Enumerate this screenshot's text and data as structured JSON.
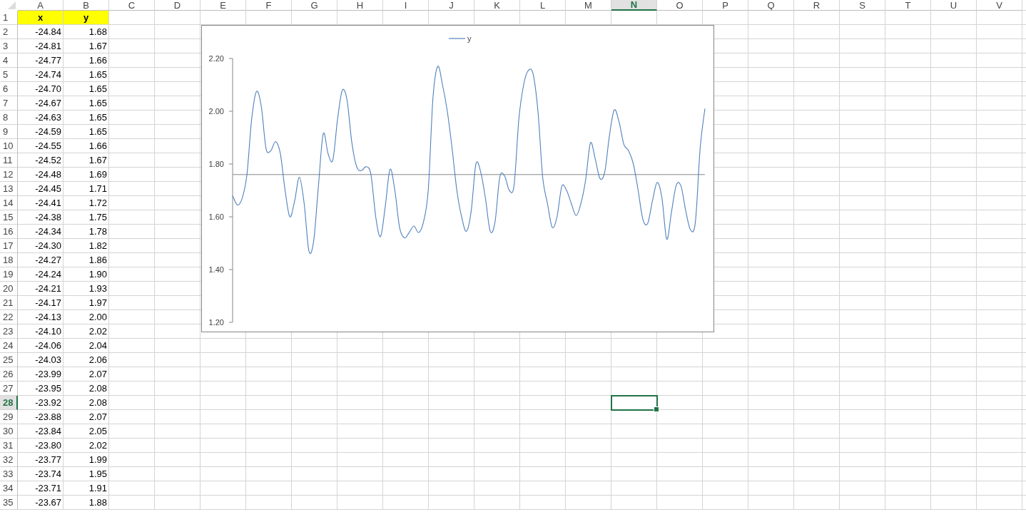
{
  "sheet": {
    "columns": [
      {
        "label": "A",
        "selected": false
      },
      {
        "label": "B",
        "selected": false
      },
      {
        "label": "C",
        "selected": false
      },
      {
        "label": "D",
        "selected": false
      },
      {
        "label": "E",
        "selected": false
      },
      {
        "label": "F",
        "selected": false
      },
      {
        "label": "G",
        "selected": false
      },
      {
        "label": "H",
        "selected": false
      },
      {
        "label": "I",
        "selected": false
      },
      {
        "label": "J",
        "selected": false
      },
      {
        "label": "K",
        "selected": false
      },
      {
        "label": "L",
        "selected": false
      },
      {
        "label": "M",
        "selected": false
      },
      {
        "label": "N",
        "selected": true
      },
      {
        "label": "O",
        "selected": false
      },
      {
        "label": "P",
        "selected": false
      },
      {
        "label": "Q",
        "selected": false
      },
      {
        "label": "R",
        "selected": false
      },
      {
        "label": "S",
        "selected": false
      },
      {
        "label": "T",
        "selected": false
      },
      {
        "label": "U",
        "selected": false
      },
      {
        "label": "V",
        "selected": false
      }
    ],
    "rows": [
      {
        "number": "1",
        "selected": false,
        "cells": [
          {
            "text": "x",
            "kind": "header"
          },
          {
            "text": "y",
            "kind": "header"
          }
        ]
      },
      {
        "number": "2",
        "selected": false,
        "cells": [
          {
            "text": "-24.84",
            "kind": "number"
          },
          {
            "text": "1.68",
            "kind": "number"
          }
        ]
      },
      {
        "number": "3",
        "selected": false,
        "cells": [
          {
            "text": "-24.81",
            "kind": "number"
          },
          {
            "text": "1.67",
            "kind": "number"
          }
        ]
      },
      {
        "number": "4",
        "selected": false,
        "cells": [
          {
            "text": "-24.77",
            "kind": "number"
          },
          {
            "text": "1.66",
            "kind": "number"
          }
        ]
      },
      {
        "number": "5",
        "selected": false,
        "cells": [
          {
            "text": "-24.74",
            "kind": "number"
          },
          {
            "text": "1.65",
            "kind": "number"
          }
        ]
      },
      {
        "number": "6",
        "selected": false,
        "cells": [
          {
            "text": "-24.70",
            "kind": "number"
          },
          {
            "text": "1.65",
            "kind": "number"
          }
        ]
      },
      {
        "number": "7",
        "selected": false,
        "cells": [
          {
            "text": "-24.67",
            "kind": "number"
          },
          {
            "text": "1.65",
            "kind": "number"
          }
        ]
      },
      {
        "number": "8",
        "selected": false,
        "cells": [
          {
            "text": "-24.63",
            "kind": "number"
          },
          {
            "text": "1.65",
            "kind": "number"
          }
        ]
      },
      {
        "number": "9",
        "selected": false,
        "cells": [
          {
            "text": "-24.59",
            "kind": "number"
          },
          {
            "text": "1.65",
            "kind": "number"
          }
        ]
      },
      {
        "number": "10",
        "selected": false,
        "cells": [
          {
            "text": "-24.55",
            "kind": "number"
          },
          {
            "text": "1.66",
            "kind": "number"
          }
        ]
      },
      {
        "number": "11",
        "selected": false,
        "cells": [
          {
            "text": "-24.52",
            "kind": "number"
          },
          {
            "text": "1.67",
            "kind": "number"
          }
        ]
      },
      {
        "number": "12",
        "selected": false,
        "cells": [
          {
            "text": "-24.48",
            "kind": "number"
          },
          {
            "text": "1.69",
            "kind": "number"
          }
        ]
      },
      {
        "number": "13",
        "selected": false,
        "cells": [
          {
            "text": "-24.45",
            "kind": "number"
          },
          {
            "text": "1.71",
            "kind": "number"
          }
        ]
      },
      {
        "number": "14",
        "selected": false,
        "cells": [
          {
            "text": "-24.41",
            "kind": "number"
          },
          {
            "text": "1.72",
            "kind": "number"
          }
        ]
      },
      {
        "number": "15",
        "selected": false,
        "cells": [
          {
            "text": "-24.38",
            "kind": "number"
          },
          {
            "text": "1.75",
            "kind": "number"
          }
        ]
      },
      {
        "number": "16",
        "selected": false,
        "cells": [
          {
            "text": "-24.34",
            "kind": "number"
          },
          {
            "text": "1.78",
            "kind": "number"
          }
        ]
      },
      {
        "number": "17",
        "selected": false,
        "cells": [
          {
            "text": "-24.30",
            "kind": "number"
          },
          {
            "text": "1.82",
            "kind": "number"
          }
        ]
      },
      {
        "number": "18",
        "selected": false,
        "cells": [
          {
            "text": "-24.27",
            "kind": "number"
          },
          {
            "text": "1.86",
            "kind": "number"
          }
        ]
      },
      {
        "number": "19",
        "selected": false,
        "cells": [
          {
            "text": "-24.24",
            "kind": "number"
          },
          {
            "text": "1.90",
            "kind": "number"
          }
        ]
      },
      {
        "number": "20",
        "selected": false,
        "cells": [
          {
            "text": "-24.21",
            "kind": "number"
          },
          {
            "text": "1.93",
            "kind": "number"
          }
        ]
      },
      {
        "number": "21",
        "selected": false,
        "cells": [
          {
            "text": "-24.17",
            "kind": "number"
          },
          {
            "text": "1.97",
            "kind": "number"
          }
        ]
      },
      {
        "number": "22",
        "selected": false,
        "cells": [
          {
            "text": "-24.13",
            "kind": "number"
          },
          {
            "text": "2.00",
            "kind": "number"
          }
        ]
      },
      {
        "number": "23",
        "selected": false,
        "cells": [
          {
            "text": "-24.10",
            "kind": "number"
          },
          {
            "text": "2.02",
            "kind": "number"
          }
        ]
      },
      {
        "number": "24",
        "selected": false,
        "cells": [
          {
            "text": "-24.06",
            "kind": "number"
          },
          {
            "text": "2.04",
            "kind": "number"
          }
        ]
      },
      {
        "number": "25",
        "selected": false,
        "cells": [
          {
            "text": "-24.03",
            "kind": "number"
          },
          {
            "text": "2.06",
            "kind": "number"
          }
        ]
      },
      {
        "number": "26",
        "selected": false,
        "cells": [
          {
            "text": "-23.99",
            "kind": "number"
          },
          {
            "text": "2.07",
            "kind": "number"
          }
        ]
      },
      {
        "number": "27",
        "selected": false,
        "cells": [
          {
            "text": "-23.95",
            "kind": "number"
          },
          {
            "text": "2.08",
            "kind": "number"
          }
        ]
      },
      {
        "number": "28",
        "selected": true,
        "cells": [
          {
            "text": "-23.92",
            "kind": "number"
          },
          {
            "text": "2.08",
            "kind": "number"
          }
        ]
      },
      {
        "number": "29",
        "selected": false,
        "cells": [
          {
            "text": "-23.88",
            "kind": "number"
          },
          {
            "text": "2.07",
            "kind": "number"
          }
        ]
      },
      {
        "number": "30",
        "selected": false,
        "cells": [
          {
            "text": "-23.84",
            "kind": "number"
          },
          {
            "text": "2.05",
            "kind": "number"
          }
        ]
      },
      {
        "number": "31",
        "selected": false,
        "cells": [
          {
            "text": "-23.80",
            "kind": "number"
          },
          {
            "text": "2.02",
            "kind": "number"
          }
        ]
      },
      {
        "number": "32",
        "selected": false,
        "cells": [
          {
            "text": "-23.77",
            "kind": "number"
          },
          {
            "text": "1.99",
            "kind": "number"
          }
        ]
      },
      {
        "number": "33",
        "selected": false,
        "cells": [
          {
            "text": "-23.74",
            "kind": "number"
          },
          {
            "text": "1.95",
            "kind": "number"
          }
        ]
      },
      {
        "number": "34",
        "selected": false,
        "cells": [
          {
            "text": "-23.71",
            "kind": "number"
          },
          {
            "text": "1.91",
            "kind": "number"
          }
        ]
      },
      {
        "number": "35",
        "selected": false,
        "cells": [
          {
            "text": "-23.67",
            "kind": "number"
          },
          {
            "text": "1.88",
            "kind": "number"
          }
        ]
      }
    ],
    "chart": {
      "chart_data": {
        "type": "line",
        "ylim": [
          1.2,
          2.2
        ],
        "yticks": [
          {
            "value": 1.2,
            "label": "1.20"
          },
          {
            "value": 1.4,
            "label": "1.40"
          },
          {
            "value": 1.6,
            "label": "1.60"
          },
          {
            "value": 1.8,
            "label": "1.80"
          },
          {
            "value": 2.0,
            "label": "2.00"
          },
          {
            "value": 2.2,
            "label": "2.20"
          }
        ],
        "ref_lines": [
          {
            "axis": "y",
            "value": 1.76
          }
        ],
        "series": [
          {
            "name": "y",
            "color": "#4f81bd",
            "values": [
              1.68,
              1.645,
              1.67,
              1.76,
              1.97,
              2.075,
              2.02,
              1.86,
              1.85,
              1.885,
              1.84,
              1.7,
              1.6,
              1.66,
              1.75,
              1.65,
              1.47,
              1.51,
              1.72,
              1.915,
              1.84,
              1.815,
              1.97,
              2.08,
              2.04,
              1.88,
              1.79,
              1.775,
              1.79,
              1.76,
              1.6,
              1.525,
              1.64,
              1.78,
              1.7,
              1.56,
              1.52,
              1.54,
              1.565,
              1.54,
              1.58,
              1.7,
              2.05,
              2.17,
              2.1,
              2.0,
              1.86,
              1.7,
              1.6,
              1.545,
              1.62,
              1.8,
              1.77,
              1.67,
              1.545,
              1.58,
              1.75,
              1.755,
              1.7,
              1.72,
              1.97,
              2.1,
              2.155,
              2.14,
              2.0,
              1.75,
              1.65,
              1.56,
              1.6,
              1.715,
              1.7,
              1.65,
              1.605,
              1.65,
              1.74,
              1.88,
              1.82,
              1.745,
              1.77,
              1.91,
              2.005,
              1.96,
              1.875,
              1.85,
              1.8,
              1.7,
              1.59,
              1.575,
              1.66,
              1.73,
              1.67,
              1.515,
              1.62,
              1.72,
              1.715,
              1.62,
              1.55,
              1.58,
              1.86,
              2.01
            ]
          }
        ]
      }
    }
  }
}
